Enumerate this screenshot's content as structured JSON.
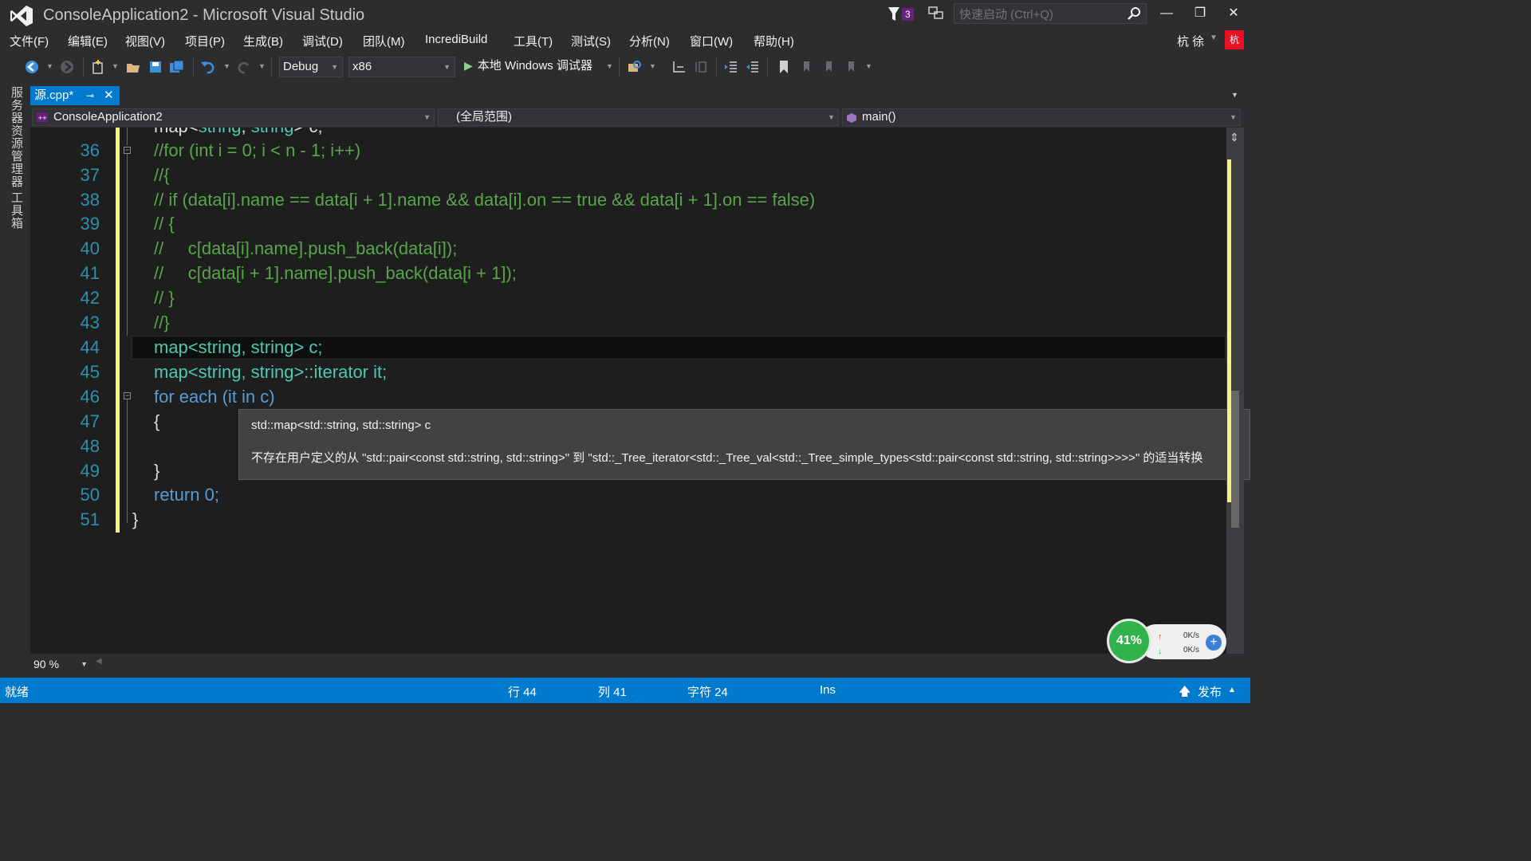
{
  "window": {
    "title": "ConsoleApplication2 - Microsoft Visual Studio",
    "notification_count": "3",
    "quick_launch_placeholder": "快速启动 (Ctrl+Q)",
    "minimize": "—",
    "restore": "❐",
    "close": "✕"
  },
  "menu": {
    "items": [
      "文件(F)",
      "编辑(E)",
      "视图(V)",
      "项目(P)",
      "生成(B)",
      "调试(D)",
      "团队(M)",
      "IncrediBuild",
      "工具(T)",
      "测试(S)",
      "分析(N)",
      "窗口(W)",
      "帮助(H)"
    ],
    "user": "杭 徐",
    "avatar": "杭"
  },
  "toolbar": {
    "configuration": "Debug",
    "platform": "x86",
    "run_label": "本地 Windows 调试器"
  },
  "side_panels": [
    "服务器资源管理器",
    "工具箱"
  ],
  "tab": {
    "label": "源.cpp*",
    "pin": "⊸",
    "close": "✕"
  },
  "navbar": {
    "project": "ConsoleApplication2",
    "scope": "(全局范围)",
    "member": "main()"
  },
  "editor": {
    "partial_top_line": "map<string, string> c;",
    "lines": [
      {
        "no": "36",
        "text": "//for (int i = 0; i < n - 1; i++)"
      },
      {
        "no": "37",
        "text": "//{"
      },
      {
        "no": "38",
        "text": "// if (data[i].name == data[i + 1].name && data[i].on == true && data[i + 1].on == false)"
      },
      {
        "no": "39",
        "text": "// {"
      },
      {
        "no": "40",
        "text": "//     c[data[i].name].push_back(data[i]);"
      },
      {
        "no": "41",
        "text": "//     c[data[i + 1].name].push_back(data[i + 1]);"
      },
      {
        "no": "42",
        "text": "// }"
      },
      {
        "no": "43",
        "text": "//}"
      },
      {
        "no": "44",
        "text": "map<string, string> c;"
      },
      {
        "no": "45",
        "text": "map<string, string>::iterator it;"
      },
      {
        "no": "46",
        "text": "for each (it in c)"
      },
      {
        "no": "47",
        "text": "{"
      },
      {
        "no": "48",
        "text": ""
      },
      {
        "no": "49",
        "text": "}"
      },
      {
        "no": "50",
        "text": "return 0;"
      },
      {
        "no": "51",
        "text": "}"
      }
    ],
    "zoom": "90 %"
  },
  "tooltip": {
    "signature": "std::map<std::string, std::string> c",
    "error": "不存在用户定义的从 \"std::pair<const std::string, std::string>\" 到 \"std::_Tree_iterator<std::_Tree_val<std::_Tree_simple_types<std::pair<const std::string, std::string>>>>\" 的适当转换"
  },
  "network_widget": {
    "cpu_percent": "41%",
    "upload": "0K/s",
    "download": "0K/s"
  },
  "status": {
    "ready": "就绪",
    "line": "行 44",
    "col": "列 41",
    "char": "字符 24",
    "mode": "Ins",
    "publish": "发布"
  },
  "colors": {
    "accent": "#007acc",
    "comment": "#57a64a",
    "keyword": "#569cd6",
    "type": "#4ec9b0",
    "line_number": "#2b91af"
  }
}
